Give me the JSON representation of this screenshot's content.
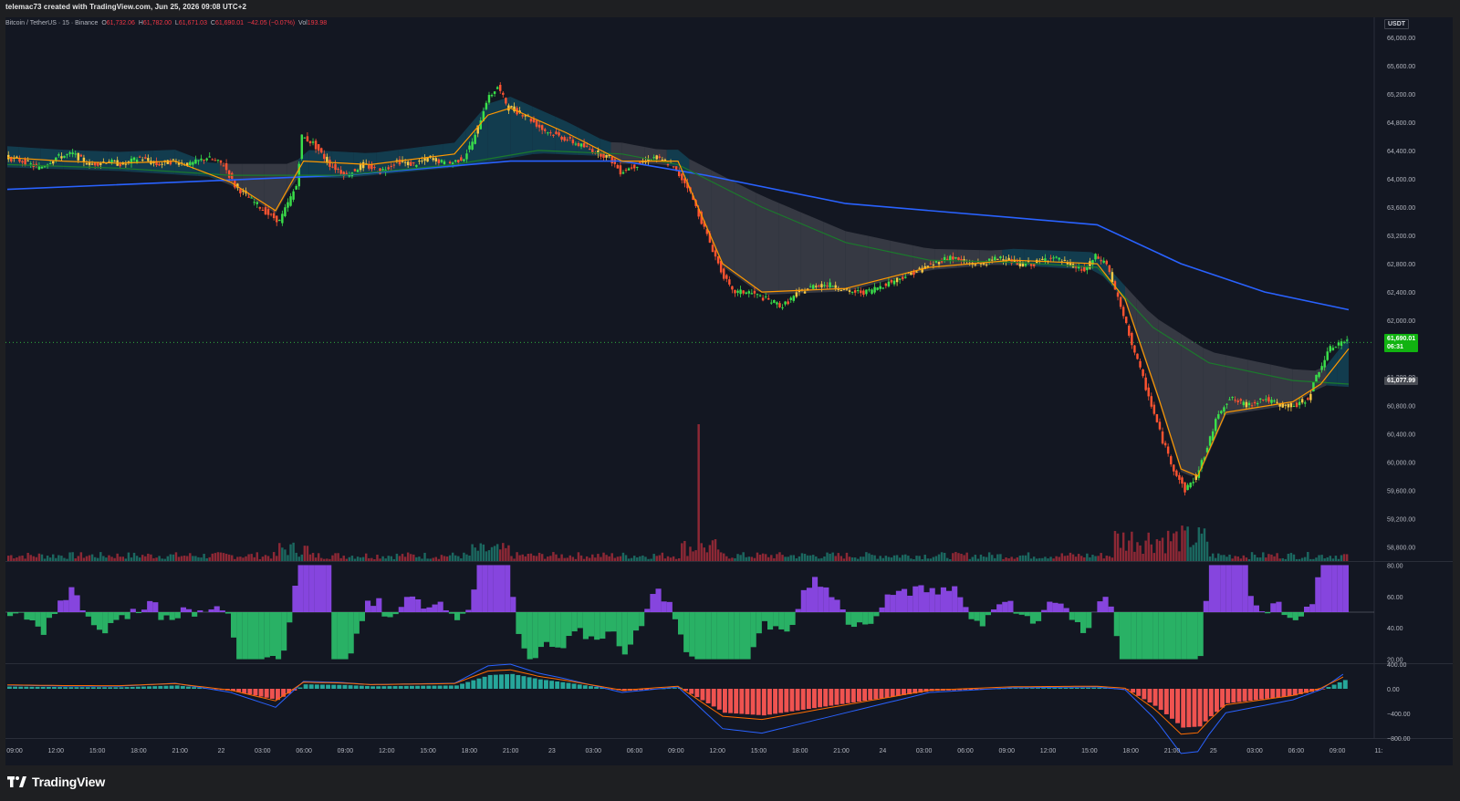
{
  "header": {
    "attribution": "telemac73 created with TradingView.com, Jun 25, 2026 09:08 UTC+2"
  },
  "legend": {
    "symbol": "Bitcoin / TetherUS · 15 · Binance",
    "o_label": "O",
    "o": "61,732.06",
    "h_label": "H",
    "h": "61,782.00",
    "l_label": "L",
    "l": "61,671.03",
    "c_label": "C",
    "c": "61,690.01",
    "change": "−42.05 (−0.07%)",
    "vol_label": "Vol",
    "vol": "193.98"
  },
  "currency_label": "USDT",
  "last_price": {
    "value": "61,690.01",
    "countdown": "06:31"
  },
  "ema_price": "61,077.99",
  "branding": {
    "name": "TradingView"
  },
  "colors": {
    "up": "#22ab94",
    "down": "#f23645",
    "bull_candle": "#3ae04a",
    "bear_candle": "#ff5330",
    "neutral_candle": "#f7c844",
    "ema_fast": "#ff9800",
    "ma_mid": "#1b7a2c",
    "ma_slow": "#2962ff",
    "cloud_up": "#134a5e",
    "cloud_down": "#43464f",
    "bg": "#131722",
    "rsi_up": "#9b4dff",
    "rsi_down": "#2ecc71",
    "macd": "#2962ff",
    "signal": "#ff6d00"
  },
  "chart_data": [
    {
      "type": "candlestick",
      "title": "Bitcoin / TetherUS · 15 · Binance",
      "x_ticks": [
        "09:00",
        "12:00",
        "15:00",
        "18:00",
        "21:00",
        "22",
        "03:00",
        "06:00",
        "09:00",
        "12:00",
        "15:00",
        "18:00",
        "21:00",
        "23",
        "03:00",
        "06:00",
        "09:00",
        "12:00",
        "15:00",
        "18:00",
        "21:00",
        "24",
        "03:00",
        "06:00",
        "09:00",
        "12:00",
        "15:00",
        "18:00",
        "21:00",
        "25",
        "03:00",
        "06:00",
        "09:00",
        "11:"
      ],
      "y_ticks": [
        "66,000.00",
        "65,600.00",
        "65,200.00",
        "64,800.00",
        "64,400.00",
        "64,000.00",
        "63,600.00",
        "63,200.00",
        "62,800.00",
        "62,400.00",
        "62,000.00",
        "61,600.00",
        "61,200.00",
        "60,800.00",
        "60,400.00",
        "60,000.00",
        "59,600.00",
        "59,200.00",
        "58,800.00"
      ],
      "ylim": [
        58600,
        66100
      ],
      "price_path": [
        [
          0,
          64300
        ],
        [
          6,
          64250
        ],
        [
          12,
          64150
        ],
        [
          18,
          64300
        ],
        [
          24,
          64350
        ],
        [
          30,
          64200
        ],
        [
          36,
          64250
        ],
        [
          42,
          64200
        ],
        [
          48,
          64300
        ],
        [
          54,
          64200
        ],
        [
          60,
          64250
        ],
        [
          66,
          64200
        ],
        [
          72,
          64300
        ],
        [
          78,
          64200
        ],
        [
          82,
          63900
        ],
        [
          88,
          63700
        ],
        [
          94,
          63500
        ],
        [
          98,
          63400
        ],
        [
          104,
          63900
        ],
        [
          106,
          64600
        ],
        [
          110,
          64500
        ],
        [
          116,
          64200
        ],
        [
          122,
          64050
        ],
        [
          128,
          64200
        ],
        [
          134,
          64100
        ],
        [
          140,
          64250
        ],
        [
          146,
          64200
        ],
        [
          152,
          64300
        ],
        [
          158,
          64200
        ],
        [
          164,
          64300
        ],
        [
          168,
          64600
        ],
        [
          172,
          65100
        ],
        [
          176,
          65300
        ],
        [
          180,
          65000
        ],
        [
          186,
          64900
        ],
        [
          192,
          64700
        ],
        [
          198,
          64600
        ],
        [
          204,
          64500
        ],
        [
          210,
          64400
        ],
        [
          216,
          64300
        ],
        [
          220,
          64100
        ],
        [
          226,
          64200
        ],
        [
          232,
          64300
        ],
        [
          238,
          64200
        ],
        [
          244,
          63900
        ],
        [
          248,
          63500
        ],
        [
          252,
          63100
        ],
        [
          256,
          62700
        ],
        [
          260,
          62400
        ],
        [
          266,
          62400
        ],
        [
          272,
          62300
        ],
        [
          278,
          62200
        ],
        [
          284,
          62400
        ],
        [
          290,
          62500
        ],
        [
          296,
          62500
        ],
        [
          302,
          62400
        ],
        [
          308,
          62400
        ],
        [
          314,
          62500
        ],
        [
          320,
          62600
        ],
        [
          326,
          62700
        ],
        [
          332,
          62800
        ],
        [
          338,
          62900
        ],
        [
          344,
          62800
        ],
        [
          350,
          62800
        ],
        [
          356,
          62900
        ],
        [
          362,
          62800
        ],
        [
          368,
          62800
        ],
        [
          374,
          62900
        ],
        [
          380,
          62800
        ],
        [
          386,
          62700
        ],
        [
          390,
          62900
        ],
        [
          394,
          62800
        ],
        [
          398,
          62300
        ],
        [
          402,
          61800
        ],
        [
          406,
          61300
        ],
        [
          410,
          60800
        ],
        [
          414,
          60300
        ],
        [
          418,
          59900
        ],
        [
          422,
          59600
        ],
        [
          426,
          59800
        ],
        [
          430,
          60200
        ],
        [
          434,
          60700
        ],
        [
          438,
          60900
        ],
        [
          444,
          60800
        ],
        [
          450,
          60900
        ],
        [
          456,
          60800
        ],
        [
          462,
          60800
        ],
        [
          466,
          60900
        ],
        [
          470,
          61300
        ],
        [
          474,
          61600
        ],
        [
          478,
          61700
        ],
        [
          480,
          61690
        ]
      ],
      "overlays": {
        "ema_fast": [
          [
            0,
            64300
          ],
          [
            20,
            64250
          ],
          [
            40,
            64220
          ],
          [
            60,
            64250
          ],
          [
            80,
            63950
          ],
          [
            96,
            63550
          ],
          [
            106,
            64250
          ],
          [
            130,
            64200
          ],
          [
            160,
            64350
          ],
          [
            172,
            64900
          ],
          [
            180,
            65000
          ],
          [
            200,
            64650
          ],
          [
            220,
            64250
          ],
          [
            240,
            64250
          ],
          [
            256,
            62800
          ],
          [
            270,
            62400
          ],
          [
            300,
            62450
          ],
          [
            330,
            62750
          ],
          [
            360,
            62850
          ],
          [
            390,
            62800
          ],
          [
            400,
            62300
          ],
          [
            412,
            60900
          ],
          [
            420,
            59900
          ],
          [
            426,
            59800
          ],
          [
            436,
            60700
          ],
          [
            460,
            60850
          ],
          [
            470,
            61100
          ],
          [
            480,
            61600
          ]
        ],
        "ma_mid": [
          [
            0,
            64200
          ],
          [
            40,
            64150
          ],
          [
            80,
            64050
          ],
          [
            120,
            64050
          ],
          [
            160,
            64200
          ],
          [
            190,
            64400
          ],
          [
            220,
            64350
          ],
          [
            240,
            64200
          ],
          [
            270,
            63600
          ],
          [
            300,
            63100
          ],
          [
            330,
            62850
          ],
          [
            360,
            62820
          ],
          [
            390,
            62750
          ],
          [
            410,
            61900
          ],
          [
            430,
            61400
          ],
          [
            460,
            61150
          ],
          [
            480,
            61100
          ]
        ],
        "ma_slow": [
          [
            0,
            63850
          ],
          [
            60,
            63950
          ],
          [
            120,
            64050
          ],
          [
            180,
            64250
          ],
          [
            220,
            64250
          ],
          [
            250,
            64050
          ],
          [
            300,
            63650
          ],
          [
            360,
            63450
          ],
          [
            390,
            63350
          ],
          [
            420,
            62800
          ],
          [
            450,
            62400
          ],
          [
            480,
            62150
          ]
        ]
      },
      "volume_max": 100
    },
    {
      "type": "area",
      "title": "",
      "y_ticks": [
        "80.00",
        "60.00",
        "40.00",
        "20.00"
      ],
      "ylim": [
        18,
        82
      ],
      "baseline": 50
    },
    {
      "type": "bar",
      "title": "",
      "y_ticks": [
        "400.00",
        "0.00",
        "−400.00",
        "−800.00"
      ],
      "ylim": [
        -800,
        400
      ]
    }
  ]
}
